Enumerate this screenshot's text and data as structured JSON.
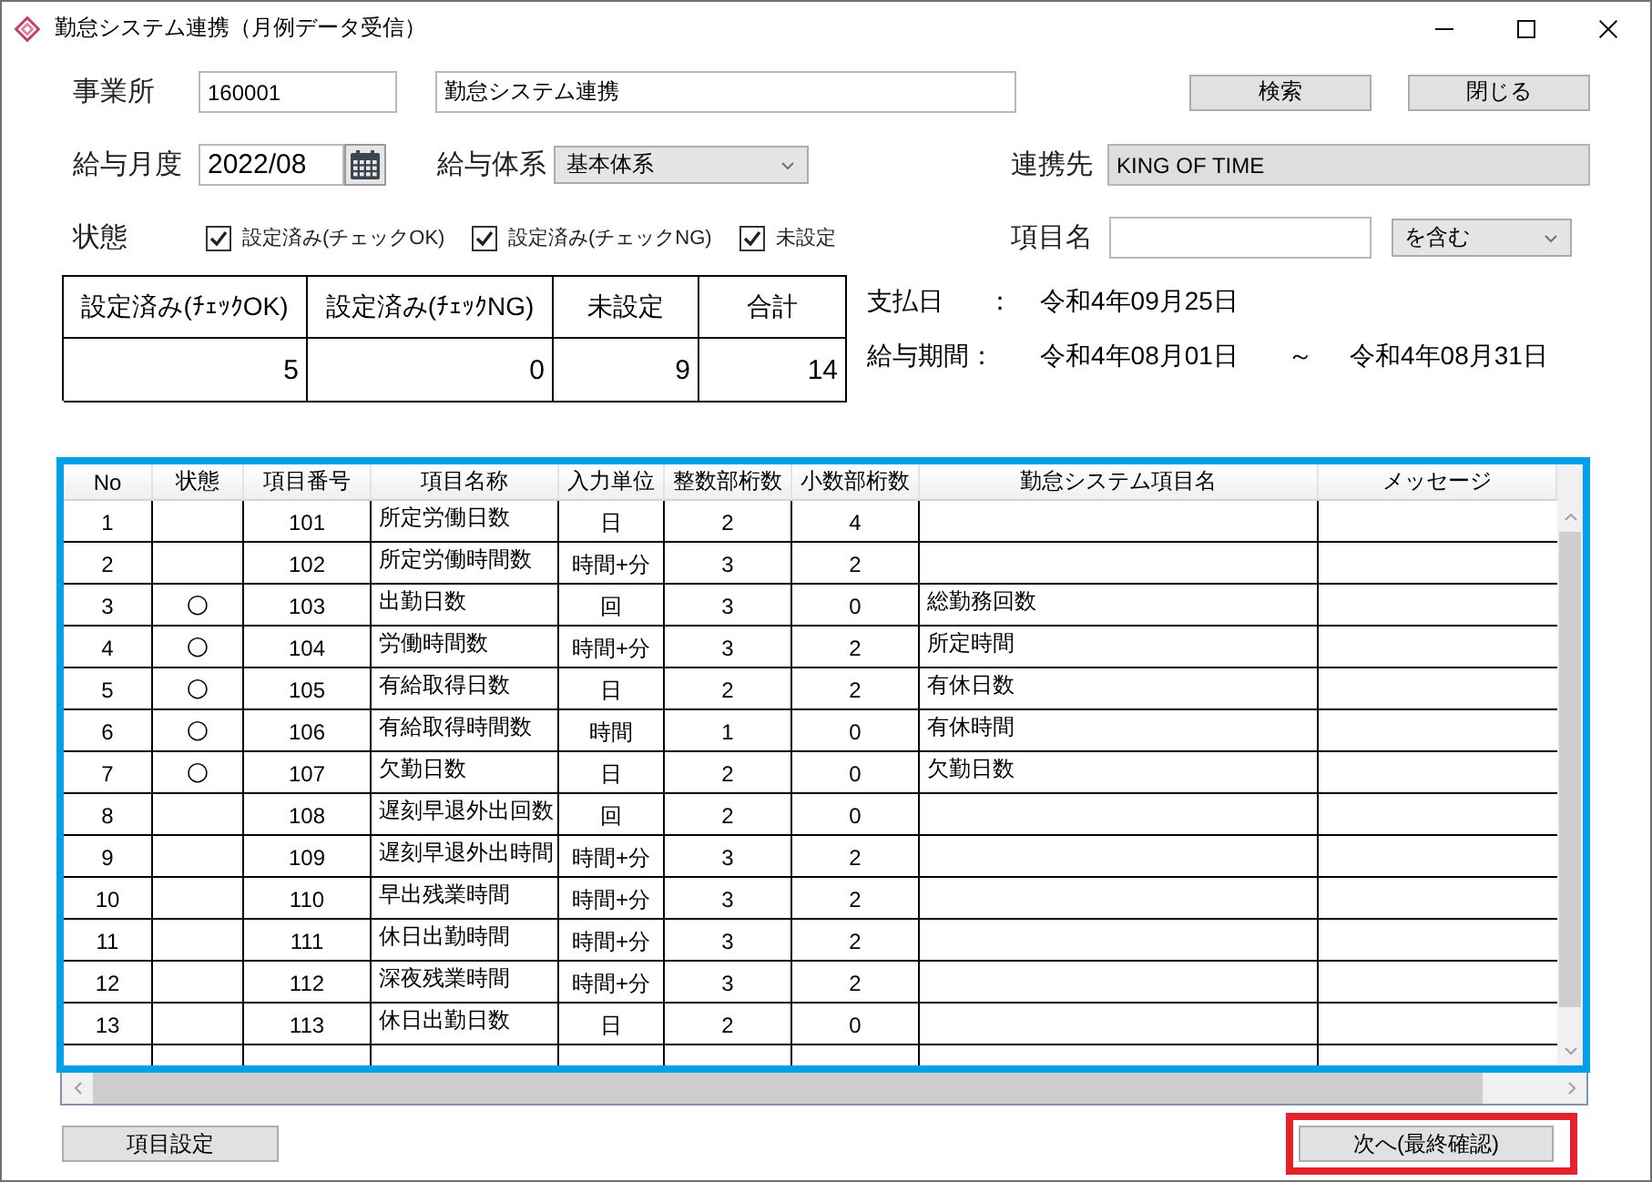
{
  "window": {
    "title": "勤怠システム連携（月例データ受信）"
  },
  "office": {
    "label": "事業所",
    "code": "160001",
    "name": "勤怠システム連携"
  },
  "actions": [
    {
      "label": "検索"
    },
    {
      "label": "閉じる"
    }
  ],
  "pay_month": {
    "label": "給与月度",
    "value": "2022/08"
  },
  "pay_system": {
    "label": "給与体系",
    "value": "基本体系"
  },
  "partner": {
    "label": "連携先",
    "value": "KING OF TIME"
  },
  "status_filter": {
    "label": "状態",
    "options": [
      {
        "label": "設定済み(チェックOK)",
        "checked": true
      },
      {
        "label": "設定済み(チェックNG)",
        "checked": true
      },
      {
        "label": "未設定",
        "checked": true
      }
    ]
  },
  "item_filter": {
    "label": "項目名",
    "match": "を含む"
  },
  "summary": {
    "columns": [
      "設定済み(ﾁｪｯｸOK)",
      "設定済み(ﾁｪｯｸNG)",
      "未設定",
      "合計"
    ],
    "values": [
      "5",
      "0",
      "9",
      "14"
    ]
  },
  "pay_date": {
    "label": "支払日",
    "separator": "：",
    "value": "令和4年09月25日"
  },
  "pay_period": {
    "label": "給与期間：",
    "from": "令和4年08月01日",
    "separator": "～",
    "to": "令和4年08月31日"
  },
  "grid": {
    "highlighted": true,
    "columns": [
      "No",
      "状態",
      "項目番号",
      "項目名称",
      "入力単位",
      "整数部桁数",
      "小数部桁数",
      "勤怠システム項目名",
      "メッセージ"
    ],
    "rows": [
      {
        "no": "1",
        "code": "101",
        "name": "所定労働日数",
        "unit": "日",
        "int_digits": "2",
        "dec_digits": "4"
      },
      {
        "no": "2",
        "code": "102",
        "name": "所定労働時間数",
        "unit": "時間+分",
        "int_digits": "3",
        "dec_digits": "2"
      },
      {
        "no": "3",
        "status": "○",
        "code": "103",
        "name": "出勤日数",
        "unit": "回",
        "int_digits": "3",
        "dec_digits": "0",
        "system_name": "総勤務回数"
      },
      {
        "no": "4",
        "status": "○",
        "code": "104",
        "name": "労働時間数",
        "unit": "時間+分",
        "int_digits": "3",
        "dec_digits": "2",
        "system_name": "所定時間"
      },
      {
        "no": "5",
        "status": "○",
        "code": "105",
        "name": "有給取得日数",
        "unit": "日",
        "int_digits": "2",
        "dec_digits": "2",
        "system_name": "有休日数"
      },
      {
        "no": "6",
        "status": "○",
        "code": "106",
        "name": "有給取得時間数",
        "unit": "時間",
        "int_digits": "1",
        "dec_digits": "0",
        "system_name": "有休時間"
      },
      {
        "no": "7",
        "status": "○",
        "code": "107",
        "name": "欠勤日数",
        "unit": "日",
        "int_digits": "2",
        "dec_digits": "0",
        "system_name": "欠勤日数"
      },
      {
        "no": "8",
        "code": "108",
        "name": "遅刻早退外出回数",
        "unit": "回",
        "int_digits": "2",
        "dec_digits": "0"
      },
      {
        "no": "9",
        "code": "109",
        "name": "遅刻早退外出時間",
        "unit": "時間+分",
        "int_digits": "3",
        "dec_digits": "2"
      },
      {
        "no": "10",
        "code": "110",
        "name": "早出残業時間",
        "unit": "時間+分",
        "int_digits": "3",
        "dec_digits": "2"
      },
      {
        "no": "11",
        "code": "111",
        "name": "休日出勤時間",
        "unit": "時間+分",
        "int_digits": "3",
        "dec_digits": "2"
      },
      {
        "no": "12",
        "code": "112",
        "name": "深夜残業時間",
        "unit": "時間+分",
        "int_digits": "3",
        "dec_digits": "2"
      },
      {
        "no": "13",
        "code": "113",
        "name": "休日出勤日数",
        "unit": "日",
        "int_digits": "2",
        "dec_digits": "0"
      }
    ]
  },
  "footer_buttons": [
    {
      "label": "項目設定",
      "highlighted": false
    },
    {
      "label": "次へ(最終確認)",
      "highlighted": true
    }
  ]
}
